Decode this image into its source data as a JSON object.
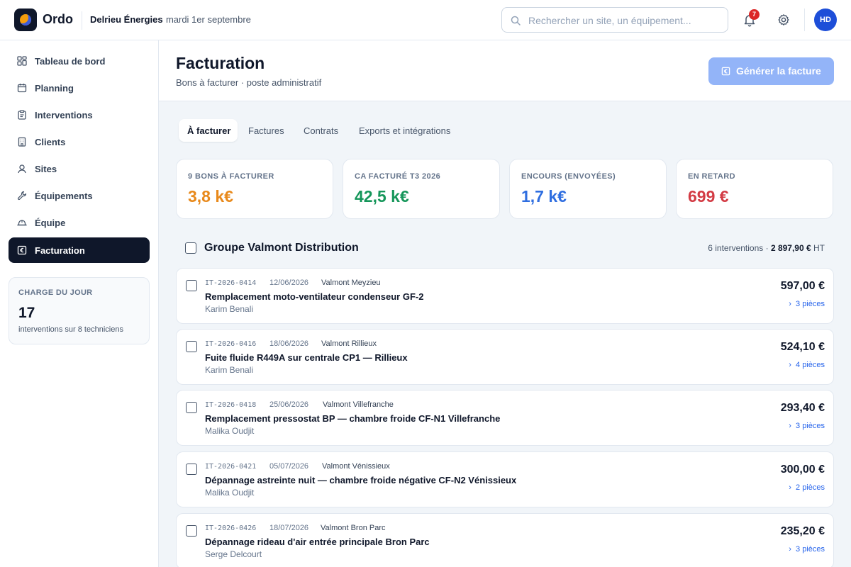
{
  "app": {
    "brand": "Ordo",
    "company": "Delrieu Énergies",
    "date": "· mardi 1er septembre"
  },
  "search": {
    "placeholder": "Rechercher un site, un équipement..."
  },
  "notifications": {
    "count": "7"
  },
  "user": {
    "initials": "HD"
  },
  "sidebar": {
    "items": [
      {
        "label": "Tableau de bord",
        "icon": "grid-icon"
      },
      {
        "label": "Planning",
        "icon": "calendar-icon"
      },
      {
        "label": "Interventions",
        "icon": "clipboard-icon"
      },
      {
        "label": "Clients",
        "icon": "building-icon"
      },
      {
        "label": "Sites",
        "icon": "map-pin-icon"
      },
      {
        "label": "Équipements",
        "icon": "wrench-icon"
      },
      {
        "label": "Équipe",
        "icon": "hard-hat-icon"
      },
      {
        "label": "Facturation",
        "icon": "euro-icon",
        "active": true
      }
    ],
    "load": {
      "title": "CHARGE DU JOUR",
      "value": "17",
      "subtitle": "interventions sur 8 techniciens"
    }
  },
  "page": {
    "title": "Facturation",
    "subtitle": "Bons à facturer · poste administratif",
    "generate_label": "Générer la facture"
  },
  "tabs": [
    {
      "label": "À facturer",
      "active": true
    },
    {
      "label": "Factures"
    },
    {
      "label": "Contrats"
    },
    {
      "label": "Exports et intégrations"
    }
  ],
  "stats": [
    {
      "label": "9 BONS À FACTURER",
      "value": "3,8 k€",
      "color": "#e8891b"
    },
    {
      "label": "CA FACTURÉ T3 2026",
      "value": "42,5 k€",
      "color": "#15965a"
    },
    {
      "label": "ENCOURS (ENVOYÉES)",
      "value": "1,7 k€",
      "color": "#2f6ee0"
    },
    {
      "label": "EN RETARD",
      "value": "699 €",
      "color": "#d33b44"
    }
  ],
  "group": {
    "title": "Groupe Valmont Distribution",
    "count_text": "6 interventions · ",
    "total": "2 897,90 €",
    "total_suffix": " HT"
  },
  "interventions": [
    {
      "code": "IT-2026-0414",
      "date": "12/06/2026",
      "site": "Valmont Meyzieu",
      "title": "Remplacement moto-ventilateur condenseur GF-2",
      "technician": "Karim Benali",
      "amount": "597,00 €",
      "parts": "3 pièces"
    },
    {
      "code": "IT-2026-0416",
      "date": "18/06/2026",
      "site": "Valmont Rillieux",
      "title": "Fuite fluide R449A sur centrale CP1 — Rillieux",
      "technician": "Karim Benali",
      "amount": "524,10 €",
      "parts": "4 pièces"
    },
    {
      "code": "IT-2026-0418",
      "date": "25/06/2026",
      "site": "Valmont Villefranche",
      "title": "Remplacement pressostat BP — chambre froide CF-N1 Villefranche",
      "technician": "Malika Oudjit",
      "amount": "293,40 €",
      "parts": "3 pièces"
    },
    {
      "code": "IT-2026-0421",
      "date": "05/07/2026",
      "site": "Valmont Vénissieux",
      "title": "Dépannage astreinte nuit — chambre froide négative CF-N2 Vénissieux",
      "technician": "Malika Oudjit",
      "amount": "300,00 €",
      "parts": "2 pièces"
    },
    {
      "code": "IT-2026-0426",
      "date": "18/07/2026",
      "site": "Valmont Bron Parc",
      "title": "Dépannage rideau d'air entrée principale Bron Parc",
      "technician": "Serge Delcourt",
      "amount": "235,20 €",
      "parts": "3 pièces"
    }
  ]
}
